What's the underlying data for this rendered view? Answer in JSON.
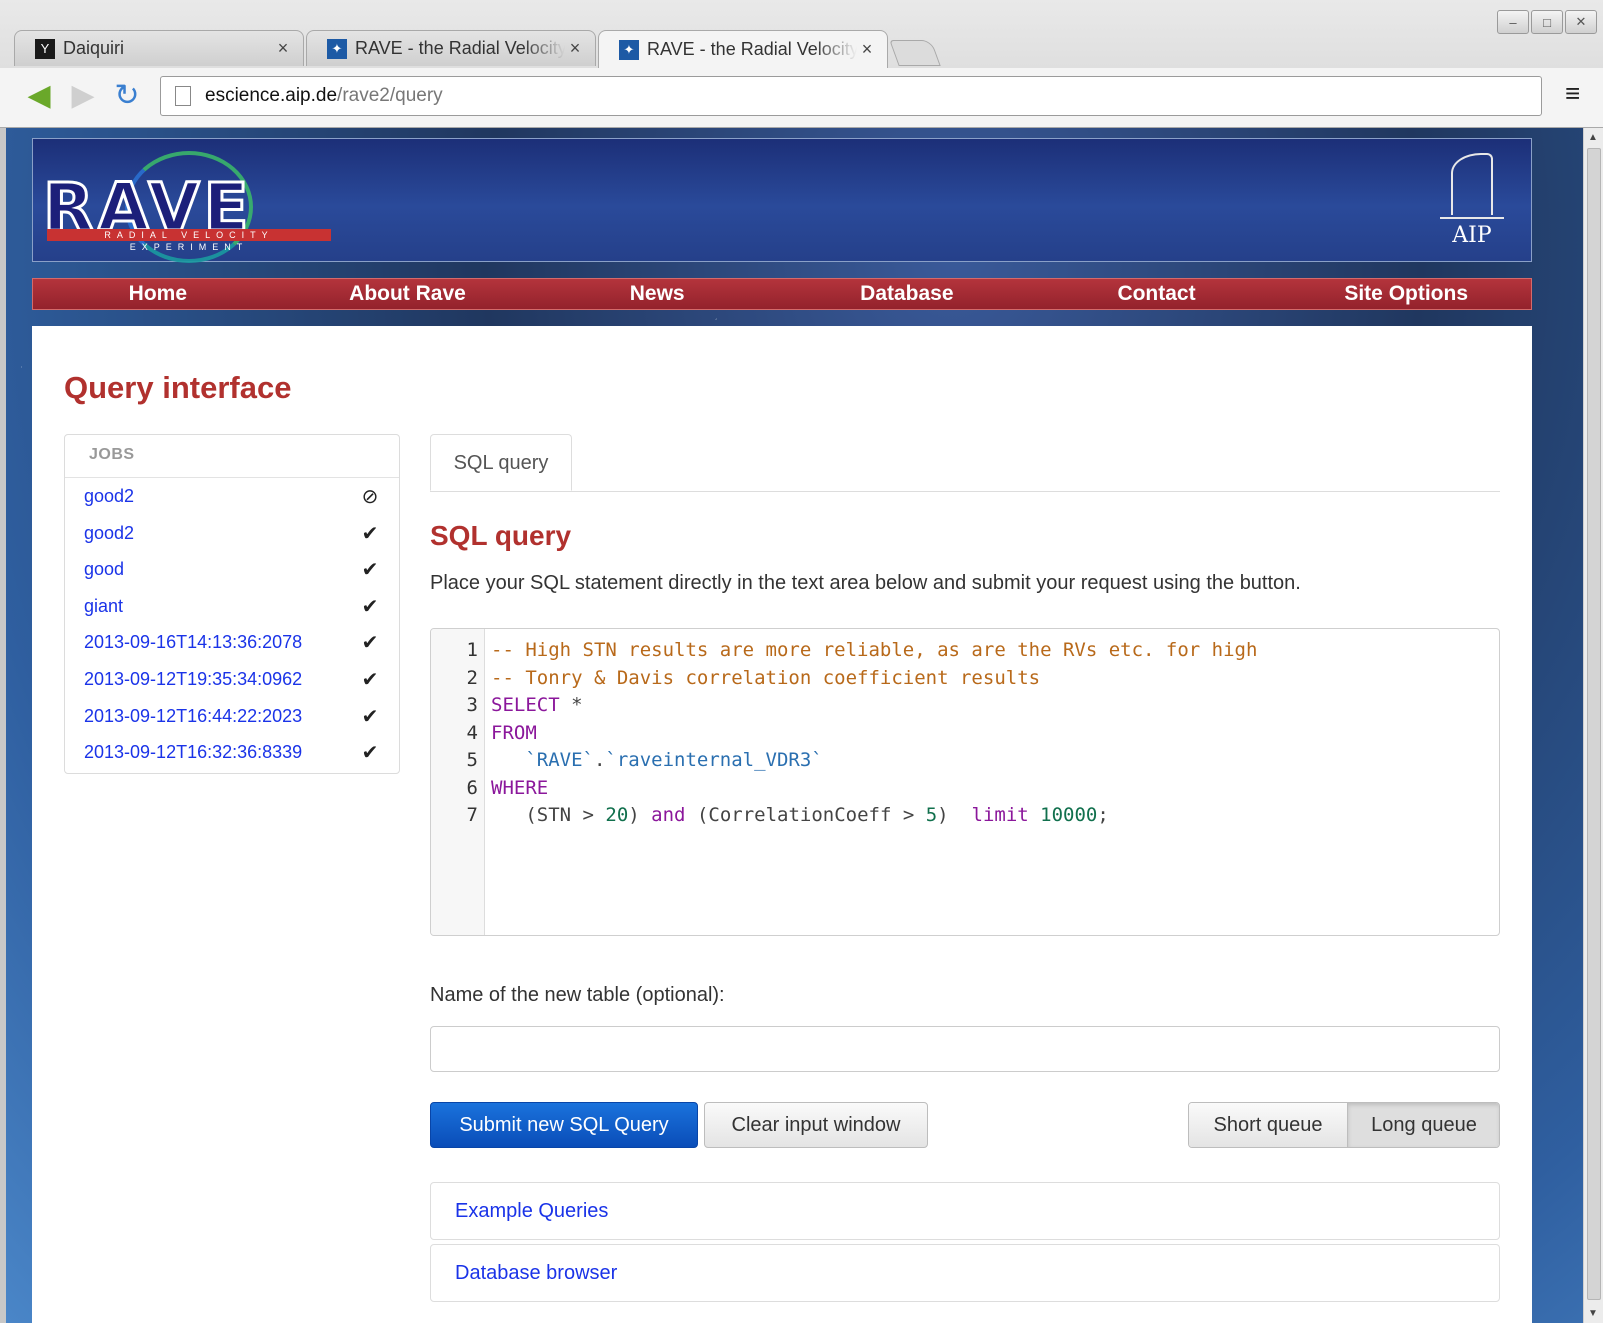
{
  "browser": {
    "tabs": [
      {
        "title": "Daiquiri",
        "icon": "daiquiri-favicon",
        "active": false
      },
      {
        "title": "RAVE - the Radial Velocity",
        "icon": "rave-favicon",
        "active": false
      },
      {
        "title": "RAVE - the Radial Velocity",
        "icon": "rave-favicon",
        "active": true
      }
    ],
    "tab_close_glyph": "×",
    "url_host": "escience.aip.de",
    "url_path": "/rave2/query",
    "window_buttons": [
      "–",
      "□",
      "✕"
    ]
  },
  "site": {
    "logo_text": "RAVE",
    "logo_subtitle": "RADIAL VELOCITY EXPERIMENT",
    "partner_logo_text": "AIP",
    "nav": [
      "Home",
      "About Rave",
      "News",
      "Database",
      "Contact",
      "Site Options"
    ]
  },
  "page": {
    "title": "Query interface"
  },
  "jobs": {
    "header": "JOBS",
    "items": [
      {
        "name": "good2",
        "status": "cancelled",
        "status_glyph": "⊘"
      },
      {
        "name": "good2",
        "status": "success",
        "status_glyph": "✔"
      },
      {
        "name": "good",
        "status": "success",
        "status_glyph": "✔"
      },
      {
        "name": "giant",
        "status": "success",
        "status_glyph": "✔"
      },
      {
        "name": "2013-09-16T14:13:36:2078",
        "status": "success",
        "status_glyph": "✔"
      },
      {
        "name": "2013-09-12T19:35:34:0962",
        "status": "success",
        "status_glyph": "✔"
      },
      {
        "name": "2013-09-12T16:44:22:2023",
        "status": "success",
        "status_glyph": "✔"
      },
      {
        "name": "2013-09-12T16:32:36:8339",
        "status": "success",
        "status_glyph": "✔"
      }
    ]
  },
  "query": {
    "tab_label": "SQL query",
    "heading": "SQL query",
    "description": "Place your SQL statement directly in the text area below and submit your request using the button.",
    "code_lines": [
      [
        {
          "t": "-- High STN results are more reliable, as are the RVs etc. for high",
          "c": "comment"
        }
      ],
      [
        {
          "t": "-- Tonry & Davis correlation coefficient results",
          "c": "comment"
        }
      ],
      [
        {
          "t": "SELECT",
          "c": "kw"
        },
        {
          "t": " *",
          "c": "plain"
        }
      ],
      [
        {
          "t": "FROM",
          "c": "kw"
        }
      ],
      [
        {
          "t": "   `RAVE`",
          "c": "str"
        },
        {
          "t": ".",
          "c": "plain"
        },
        {
          "t": "`raveinternal_VDR3`",
          "c": "str"
        }
      ],
      [
        {
          "t": "WHERE",
          "c": "kw"
        }
      ],
      [
        {
          "t": "   (STN > ",
          "c": "plain"
        },
        {
          "t": "20",
          "c": "num"
        },
        {
          "t": ") ",
          "c": "plain"
        },
        {
          "t": "and",
          "c": "kw"
        },
        {
          "t": " (CorrelationCoeff > ",
          "c": "plain"
        },
        {
          "t": "5",
          "c": "num"
        },
        {
          "t": ")  ",
          "c": "plain"
        },
        {
          "t": "limit",
          "c": "kw"
        },
        {
          "t": " ",
          "c": "plain"
        },
        {
          "t": "10000",
          "c": "num"
        },
        {
          "t": ";",
          "c": "plain"
        }
      ]
    ],
    "table_label": "Name of the new table (optional):",
    "table_value": "",
    "submit_label": "Submit new SQL Query",
    "clear_label": "Clear input window",
    "queue_short": "Short queue",
    "queue_long": "Long queue",
    "queue_selected": "Long queue"
  },
  "panels": {
    "examples": "Example Queries",
    "browser": "Database browser"
  }
}
